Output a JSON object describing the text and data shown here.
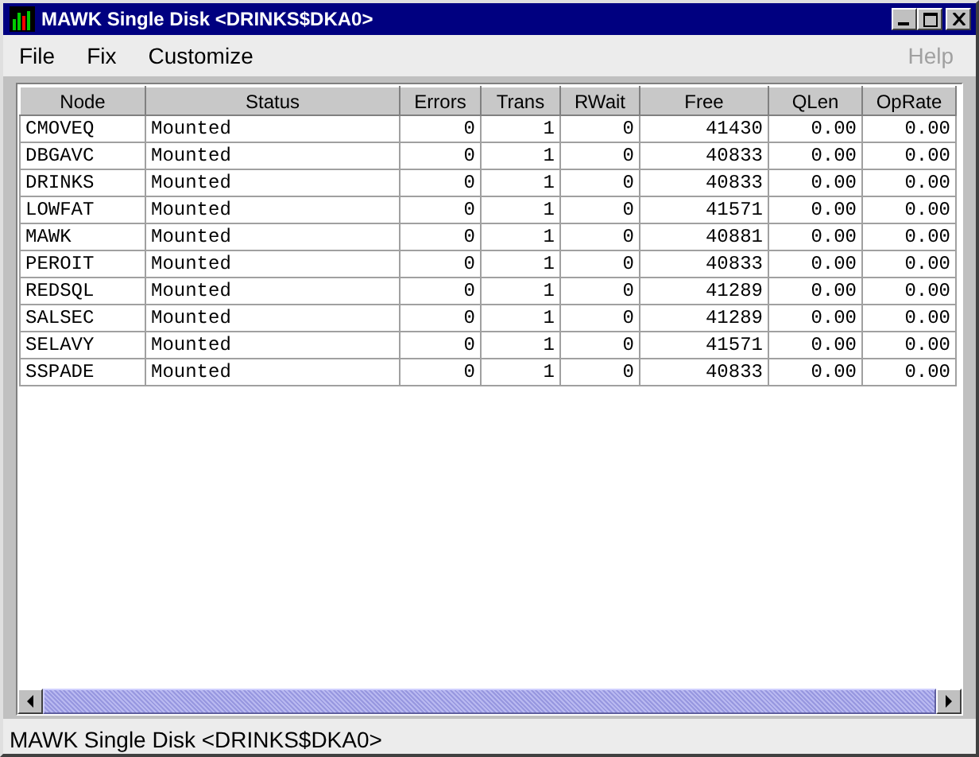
{
  "window": {
    "title": "MAWK Single Disk <DRINKS$DKA0>"
  },
  "menu": [
    {
      "label": "File",
      "disabled": false
    },
    {
      "label": "Fix",
      "disabled": false
    },
    {
      "label": "Customize",
      "disabled": false
    },
    {
      "label": "Help",
      "disabled": true
    }
  ],
  "table": {
    "columns": [
      "Node",
      "Status",
      "Errors",
      "Trans",
      "RWait",
      "Free",
      "QLen",
      "OpRate"
    ],
    "rows": [
      [
        "CMOVEQ",
        "Mounted",
        "0",
        "1",
        "0",
        "41430",
        "0.00",
        "0.00"
      ],
      [
        "DBGAVC",
        "Mounted",
        "0",
        "1",
        "0",
        "40833",
        "0.00",
        "0.00"
      ],
      [
        "DRINKS",
        "Mounted",
        "0",
        "1",
        "0",
        "40833",
        "0.00",
        "0.00"
      ],
      [
        "LOWFAT",
        "Mounted",
        "0",
        "1",
        "0",
        "41571",
        "0.00",
        "0.00"
      ],
      [
        "MAWK",
        "Mounted",
        "0",
        "1",
        "0",
        "40881",
        "0.00",
        "0.00"
      ],
      [
        "PEROIT",
        "Mounted",
        "0",
        "1",
        "0",
        "40833",
        "0.00",
        "0.00"
      ],
      [
        "REDSQL",
        "Mounted",
        "0",
        "1",
        "0",
        "41289",
        "0.00",
        "0.00"
      ],
      [
        "SALSEC",
        "Mounted",
        "0",
        "1",
        "0",
        "41289",
        "0.00",
        "0.00"
      ],
      [
        "SELAVY",
        "Mounted",
        "0",
        "1",
        "0",
        "41571",
        "0.00",
        "0.00"
      ],
      [
        "SSPADE",
        "Mounted",
        "0",
        "1",
        "0",
        "40833",
        "0.00",
        "0.00"
      ]
    ]
  },
  "status_bar": "MAWK Single Disk <DRINKS$DKA0>"
}
